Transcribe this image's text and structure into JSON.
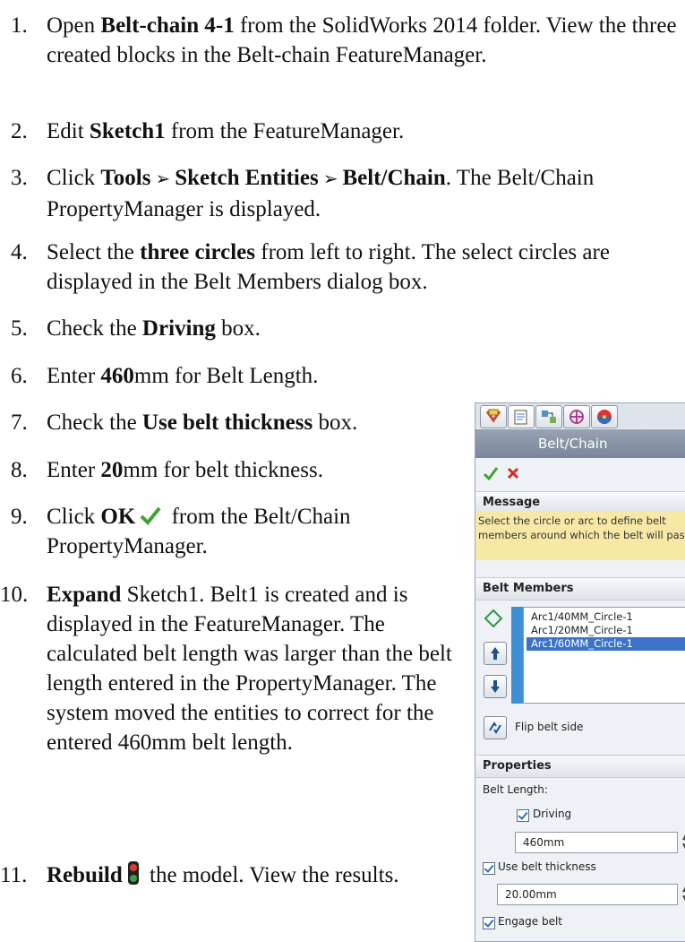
{
  "steps": [
    {
      "num": "1.",
      "parts": [
        [
          "t",
          "Open "
        ],
        [
          "b",
          "Belt-chain 4-1"
        ],
        [
          "t",
          " from the SolidWorks 2014 folder. View the three created blocks in the Belt-chain FeatureManager."
        ]
      ]
    },
    {
      "num": "2.",
      "parts": [
        [
          "t",
          "Edit "
        ],
        [
          "b",
          "Sketch1"
        ],
        [
          "t",
          " from the FeatureManager."
        ]
      ]
    },
    {
      "num": "3.",
      "parts": [
        [
          "t",
          "Click "
        ],
        [
          "b",
          "Tools"
        ],
        [
          "a",
          " ➢ "
        ],
        [
          "b",
          "Sketch Entities"
        ],
        [
          "a",
          " ➢ "
        ],
        [
          "b",
          "Belt/Chain"
        ],
        [
          "t",
          ". The Belt/Chain PropertyManager is displayed."
        ]
      ]
    },
    {
      "num": "4.",
      "parts": [
        [
          "t",
          "Select the "
        ],
        [
          "b",
          "three circles"
        ],
        [
          "t",
          " from left to right. The select circles are displayed in the Belt Members dialog box."
        ]
      ]
    },
    {
      "num": "5.",
      "parts": [
        [
          "t",
          "Check the "
        ],
        [
          "b",
          "Driving"
        ],
        [
          "t",
          " box."
        ]
      ]
    },
    {
      "num": "6.",
      "parts": [
        [
          "t",
          "Enter "
        ],
        [
          "b",
          "460"
        ],
        [
          "t",
          "mm for Belt Length."
        ]
      ]
    },
    {
      "num": "7.",
      "parts": [
        [
          "t",
          "Check the "
        ],
        [
          "b",
          "Use belt thickness"
        ],
        [
          "t",
          " box."
        ]
      ]
    },
    {
      "num": "8.",
      "parts": [
        [
          "t",
          "Enter "
        ],
        [
          "b",
          "20"
        ],
        [
          "t",
          "mm for belt thickness."
        ]
      ]
    },
    {
      "num": "9.",
      "parts": [
        [
          "t",
          "Click "
        ],
        [
          "b",
          "OK"
        ],
        [
          "ok",
          ""
        ],
        [
          "t",
          " from the Belt/Chain PropertyManager."
        ]
      ]
    },
    {
      "num": "10.",
      "parts": [
        [
          "b",
          "Expand"
        ],
        [
          "t",
          " Sketch1. Belt1 is created and is displayed in the FeatureManager. The calculated belt length was larger than the belt length entered in the PropertyManager. The system moved the entities to correct for the entered 460mm belt length."
        ]
      ]
    },
    {
      "num": "11.",
      "parts": [
        [
          "b",
          "Rebuild"
        ],
        [
          "rb",
          ""
        ],
        [
          "t",
          " the model. View the results."
        ]
      ]
    }
  ],
  "panel": {
    "title": "Belt/Chain",
    "help": "?",
    "message_header": "Message",
    "message_text": "Select the circle or arc to define belt members around which the belt will pass",
    "members_header": "Belt Members",
    "members": [
      "Arc1/40MM_Circle-1",
      "Arc1/20MM_Circle-1",
      "Arc1/60MM_Circle-1"
    ],
    "flip_label": "Flip belt side",
    "properties_header": "Properties",
    "belt_length_label": "Belt Length:",
    "driving_label": "Driving",
    "length_value": "460mm",
    "thickness_label": "Use belt thickness",
    "thickness_value": "20.00mm",
    "engage_label": "Engage belt"
  }
}
